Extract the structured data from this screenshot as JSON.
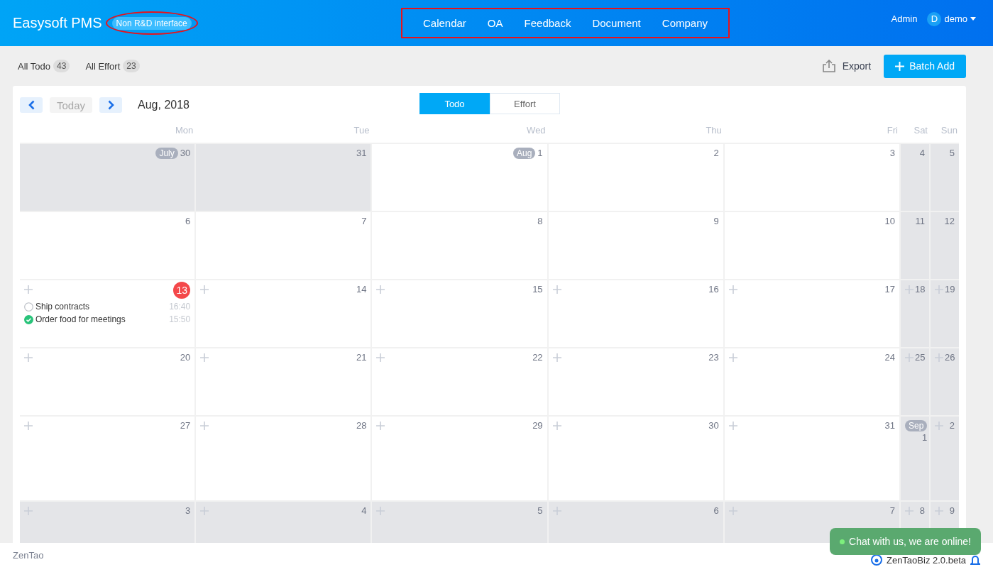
{
  "header": {
    "brand": "Easysoft PMS",
    "badge": {
      "label": "Non R&D interface",
      "circled": true
    },
    "nav": {
      "boxed": true,
      "items": [
        "Calendar",
        "OA",
        "Feedback",
        "Document",
        "Company"
      ]
    },
    "role": "Admin",
    "avatar": "D",
    "user": "demo"
  },
  "toolbar": {
    "filters": [
      {
        "label": "All Todo",
        "count": "43"
      },
      {
        "label": "All Effort",
        "count": "23"
      }
    ],
    "export": "Export",
    "batch_add": "Batch Add"
  },
  "calendar": {
    "today_button": {
      "label": "Today",
      "disabled": true
    },
    "month": "Aug, 2018",
    "views": [
      {
        "label": "Todo",
        "selected": true
      },
      {
        "label": "Effort",
        "selected": false
      }
    ],
    "weekdays": [
      "Mon",
      "Tue",
      "Wed",
      "Thu",
      "Fri",
      "Sat",
      "Sun"
    ],
    "weeks": [
      {
        "days": [
          {
            "day": "30",
            "tag": "July",
            "shaded": true,
            "add": false
          },
          {
            "day": "31",
            "shaded": true,
            "add": false
          },
          {
            "day": "1",
            "tag": "Aug",
            "shaded": false,
            "add": false
          },
          {
            "day": "2",
            "shaded": false,
            "add": false
          },
          {
            "day": "3",
            "shaded": false,
            "add": false
          },
          {
            "day": "4",
            "shaded": true,
            "add": false
          },
          {
            "day": "5",
            "shaded": true,
            "add": false
          }
        ]
      },
      {
        "days": [
          {
            "day": "6",
            "shaded": false,
            "add": false
          },
          {
            "day": "7",
            "shaded": false,
            "add": false
          },
          {
            "day": "8",
            "shaded": false,
            "add": false
          },
          {
            "day": "9",
            "shaded": false,
            "add": false
          },
          {
            "day": "10",
            "shaded": false,
            "add": false
          },
          {
            "day": "11",
            "shaded": true,
            "add": false
          },
          {
            "day": "12",
            "shaded": true,
            "add": false
          }
        ]
      },
      {
        "days": [
          {
            "day": "13",
            "today": true,
            "shaded": false,
            "add": true,
            "events": [
              {
                "title": "Ship contracts",
                "time": "16:40",
                "done": false
              },
              {
                "title": "Order food for meetings",
                "time": "15:50",
                "done": true
              }
            ]
          },
          {
            "day": "14",
            "shaded": false,
            "add": true
          },
          {
            "day": "15",
            "shaded": false,
            "add": true
          },
          {
            "day": "16",
            "shaded": false,
            "add": true
          },
          {
            "day": "17",
            "shaded": false,
            "add": true
          },
          {
            "day": "18",
            "shaded": true,
            "add": true
          },
          {
            "day": "19",
            "shaded": true,
            "add": true
          }
        ]
      },
      {
        "days": [
          {
            "day": "20",
            "shaded": false,
            "add": true
          },
          {
            "day": "21",
            "shaded": false,
            "add": true
          },
          {
            "day": "22",
            "shaded": false,
            "add": true
          },
          {
            "day": "23",
            "shaded": false,
            "add": true
          },
          {
            "day": "24",
            "shaded": false,
            "add": true
          },
          {
            "day": "25",
            "shaded": true,
            "add": true
          },
          {
            "day": "26",
            "shaded": true,
            "add": true
          }
        ]
      },
      {
        "days": [
          {
            "day": "27",
            "shaded": false,
            "add": true
          },
          {
            "day": "28",
            "shaded": false,
            "add": true
          },
          {
            "day": "29",
            "shaded": false,
            "add": true
          },
          {
            "day": "30",
            "shaded": false,
            "add": true
          },
          {
            "day": "31",
            "shaded": false,
            "add": true
          },
          {
            "day": "1",
            "tag": "Sep",
            "shaded": true,
            "add": false
          },
          {
            "day": "2",
            "shaded": true,
            "add": true
          }
        ]
      },
      {
        "days": [
          {
            "day": "3",
            "shaded": true,
            "add": true
          },
          {
            "day": "4",
            "shaded": true,
            "add": true
          },
          {
            "day": "5",
            "shaded": true,
            "add": true
          },
          {
            "day": "6",
            "shaded": true,
            "add": true
          },
          {
            "day": "7",
            "shaded": true,
            "add": true
          },
          {
            "day": "8",
            "shaded": true,
            "add": true
          },
          {
            "day": "9",
            "shaded": true,
            "add": true
          }
        ]
      }
    ]
  },
  "footer": {
    "left": "ZenTao",
    "version": "ZenTaoBiz 2.0.beta"
  },
  "chat": {
    "label": "Chat with us, we are online!"
  }
}
